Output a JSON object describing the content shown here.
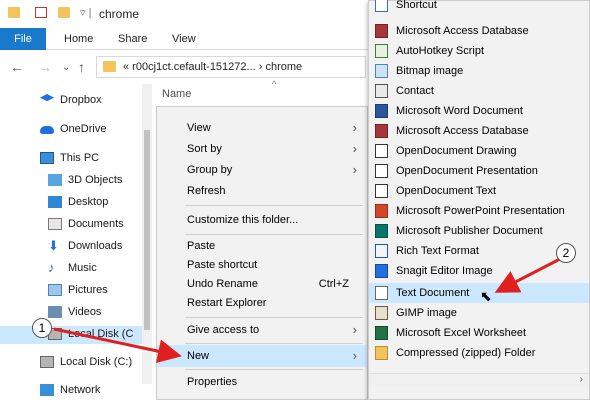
{
  "window": {
    "title": "chrome"
  },
  "ribbon": {
    "tabs": [
      "File",
      "Home",
      "Share",
      "View"
    ]
  },
  "address": {
    "path": "« r00cj1ct.cefault-151272... › chrome"
  },
  "nav_pane": {
    "items": [
      {
        "label": "Dropbox",
        "icon": "dropbox-icon"
      },
      {
        "label": "OneDrive",
        "icon": "onedrive-icon"
      },
      {
        "label": "This PC",
        "icon": "computer-icon"
      },
      {
        "label": "3D Objects",
        "icon": "3d-objects-icon"
      },
      {
        "label": "Desktop",
        "icon": "desktop-icon"
      },
      {
        "label": "Documents",
        "icon": "documents-icon"
      },
      {
        "label": "Downloads",
        "icon": "downloads-icon"
      },
      {
        "label": "Music",
        "icon": "music-icon"
      },
      {
        "label": "Pictures",
        "icon": "pictures-icon"
      },
      {
        "label": "Videos",
        "icon": "videos-icon"
      },
      {
        "label": "Local Disk (C",
        "icon": "drive-icon"
      },
      {
        "label": "Local Disk (C:)",
        "icon": "drive-icon"
      },
      {
        "label": "Network",
        "icon": "network-icon"
      }
    ]
  },
  "file_list": {
    "column_name": "Name"
  },
  "context_menu": {
    "items": [
      {
        "label": "View",
        "shortcut": "",
        "arrow": "›"
      },
      {
        "label": "Sort by",
        "shortcut": "",
        "arrow": "›"
      },
      {
        "label": "Group by",
        "shortcut": "",
        "arrow": "›"
      },
      {
        "label": "Refresh",
        "shortcut": "",
        "arrow": ""
      },
      {
        "label": "Customize this folder...",
        "shortcut": "",
        "arrow": ""
      },
      {
        "label": "Paste",
        "shortcut": "",
        "arrow": ""
      },
      {
        "label": "Paste shortcut",
        "shortcut": "",
        "arrow": ""
      },
      {
        "label": "Undo Rename",
        "shortcut": "Ctrl+Z",
        "arrow": ""
      },
      {
        "label": "Restart Explorer",
        "shortcut": "",
        "arrow": ""
      },
      {
        "label": "Give access to",
        "shortcut": "",
        "arrow": "›"
      },
      {
        "label": "New",
        "shortcut": "",
        "arrow": "›"
      },
      {
        "label": "Properties",
        "shortcut": "",
        "arrow": ""
      }
    ]
  },
  "new_submenu": {
    "items": [
      {
        "label": "Shortcut",
        "icon": "shortcut-icon"
      },
      {
        "label": "Microsoft Access Database",
        "icon": "access-icon"
      },
      {
        "label": "AutoHotkey Script",
        "icon": "autohotkey-icon"
      },
      {
        "label": "Bitmap image",
        "icon": "bitmap-icon"
      },
      {
        "label": "Contact",
        "icon": "contact-icon"
      },
      {
        "label": "Microsoft Word Document",
        "icon": "word-icon"
      },
      {
        "label": "Microsoft Access Database",
        "icon": "access-icon"
      },
      {
        "label": "OpenDocument Drawing",
        "icon": "odg-icon"
      },
      {
        "label": "OpenDocument Presentation",
        "icon": "odp-icon"
      },
      {
        "label": "OpenDocument Text",
        "icon": "odt-icon"
      },
      {
        "label": "Microsoft PowerPoint Presentation",
        "icon": "powerpoint-icon"
      },
      {
        "label": "Microsoft Publisher Document",
        "icon": "publisher-icon"
      },
      {
        "label": "Rich Text Format",
        "icon": "rtf-icon"
      },
      {
        "label": "Snagit Editor Image",
        "icon": "snagit-icon"
      },
      {
        "label": "Text Document",
        "icon": "text-document-icon"
      },
      {
        "label": "GIMP image",
        "icon": "gimp-icon"
      },
      {
        "label": "Microsoft Excel Worksheet",
        "icon": "excel-icon"
      },
      {
        "label": "Compressed (zipped) Folder",
        "icon": "zip-folder-icon"
      }
    ]
  },
  "callouts": [
    "1",
    "2"
  ],
  "colors": {
    "file_tab": "#1979ca",
    "highlight": "#cce8ff",
    "menu_bg": "#f2f2f2",
    "arrow_red": "#e02020"
  }
}
